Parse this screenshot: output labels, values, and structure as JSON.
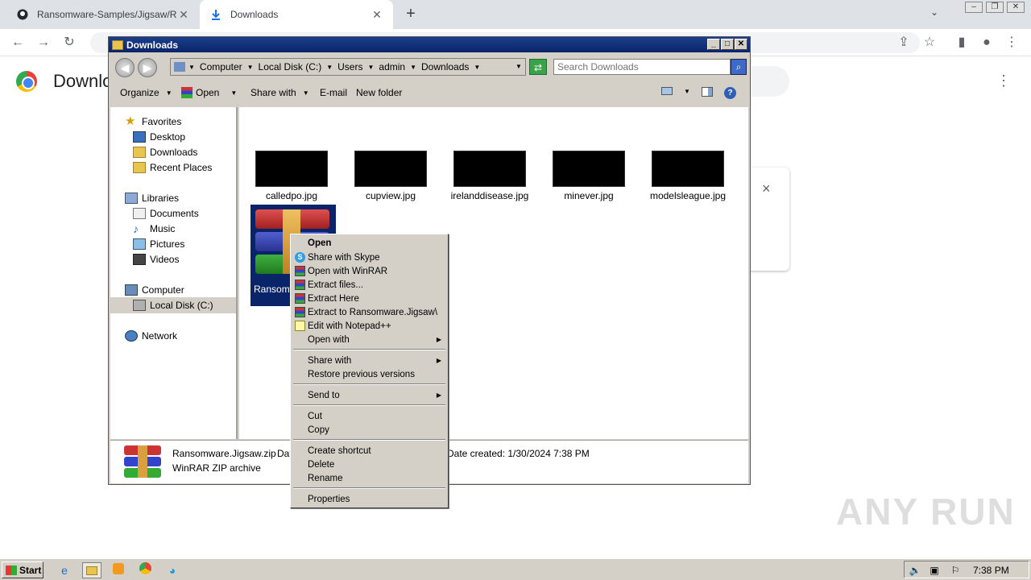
{
  "browser": {
    "tabs": [
      {
        "title": "Ransomware-Samples/Jigsaw/Ransomware.Jigsaw.zip",
        "icon": "github-icon"
      },
      {
        "title": "Downloads",
        "icon": "download-icon"
      }
    ],
    "page_heading": "Downloads",
    "card_close": "×",
    "watermark": "ANY RUN"
  },
  "explorer": {
    "title": "Downloads",
    "breadcrumb": [
      "Computer",
      "Local Disk (C:)",
      "Users",
      "admin",
      "Downloads"
    ],
    "search_placeholder": "Search Downloads",
    "commands": {
      "organize": "Organize",
      "open": "Open",
      "share_with": "Share with",
      "email": "E-mail",
      "new_folder": "New folder"
    },
    "nav": {
      "favorites": "Favorites",
      "desktop": "Desktop",
      "downloads": "Downloads",
      "recent": "Recent Places",
      "libraries": "Libraries",
      "documents": "Documents",
      "music": "Music",
      "pictures": "Pictures",
      "videos": "Videos",
      "computer": "Computer",
      "local_disk": "Local Disk (C:)",
      "network": "Network"
    },
    "files": [
      {
        "name": "calledpo.jpg"
      },
      {
        "name": "cupview.jpg"
      },
      {
        "name": "irelanddisease.jpg"
      },
      {
        "name": "minever.jpg"
      },
      {
        "name": "modelsleague.jpg"
      }
    ],
    "selected_file_label": "Ransomw... w",
    "details": {
      "name": "Ransomware.Jigsaw.zip",
      "date_label": "Dat",
      "type": "WinRAR ZIP archive",
      "created": "Date created: 1/30/2024 7:38 PM"
    }
  },
  "context_menu": {
    "open": "Open",
    "share_skype": "Share with Skype",
    "open_winrar": "Open with WinRAR",
    "extract_files": "Extract files...",
    "extract_here": "Extract Here",
    "extract_to": "Extract to Ransomware.Jigsaw\\",
    "edit_npp": "Edit with Notepad++",
    "open_with": "Open with",
    "share_with": "Share with",
    "restore": "Restore previous versions",
    "send_to": "Send to",
    "cut": "Cut",
    "copy": "Copy",
    "create_shortcut": "Create shortcut",
    "delete": "Delete",
    "rename": "Rename",
    "properties": "Properties"
  },
  "taskbar": {
    "start": "Start",
    "clock": "7:38 PM"
  }
}
